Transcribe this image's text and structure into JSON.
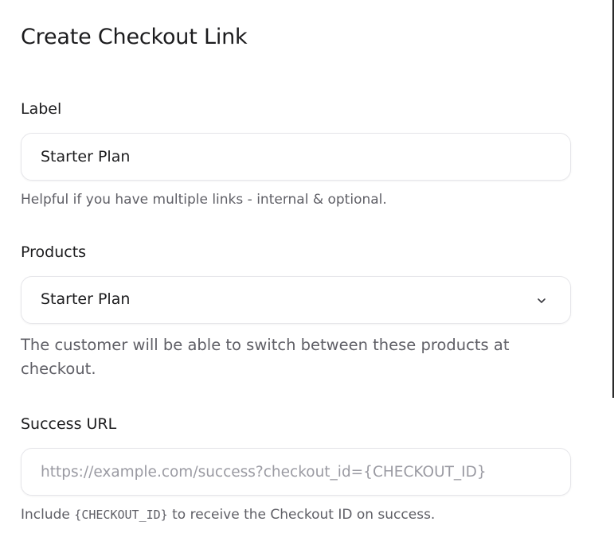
{
  "page": {
    "title": "Create Checkout Link"
  },
  "label_field": {
    "label": "Label",
    "value": "Starter Plan",
    "help": "Helpful if you have multiple links - internal & optional."
  },
  "products_field": {
    "label": "Products",
    "selected": "Starter Plan",
    "help": "The customer will be able to switch between these products at checkout."
  },
  "success_url_field": {
    "label": "Success URL",
    "value": "",
    "placeholder": "https://example.com/success?checkout_id={CHECKOUT_ID}",
    "help_prefix": "Include ",
    "help_code": "{CHECKOUT_ID}",
    "help_suffix": " to receive the Checkout ID on success."
  },
  "icons": {
    "select_chevron": "chevron-down-icon"
  }
}
